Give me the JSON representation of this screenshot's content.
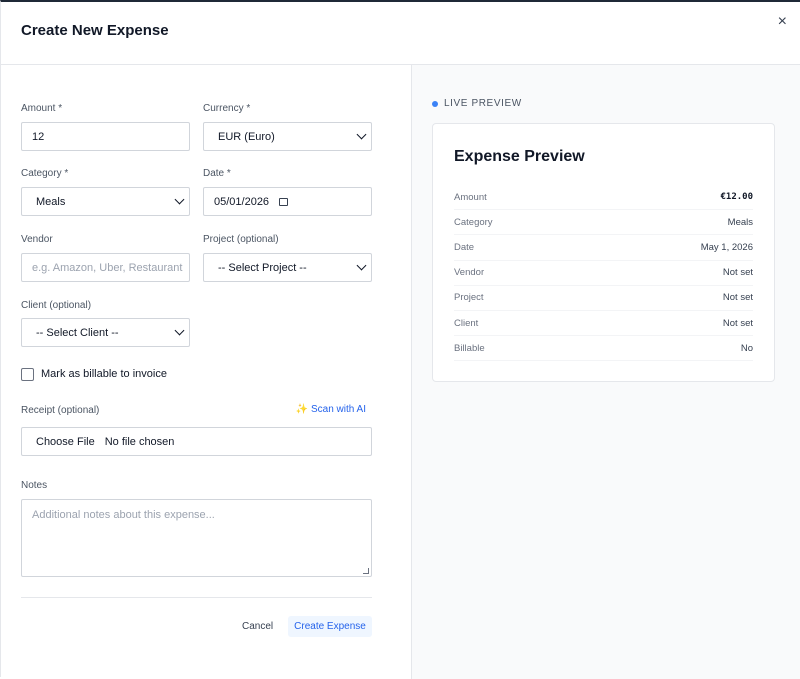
{
  "dialog": {
    "title": "Create New Expense",
    "close_glyph": "×"
  },
  "form": {
    "amount": {
      "label": "Amount *",
      "value": "12"
    },
    "currency": {
      "label": "Currency *",
      "value": "EUR (Euro)"
    },
    "category": {
      "label": "Category *",
      "value": "Meals"
    },
    "date": {
      "label": "Date *",
      "value": "05/01/2026"
    },
    "vendor": {
      "label": "Vendor",
      "placeholder": "e.g. Amazon, Uber, Restaurant"
    },
    "project": {
      "label": "Project (optional)",
      "value": "-- Select Project --"
    },
    "client": {
      "label": "Client (optional)",
      "value": "-- Select Client --"
    },
    "billable": {
      "label": "Mark as billable to invoice",
      "checked": false
    },
    "receipt": {
      "label": "Receipt (optional)",
      "scan_label": "✨ Scan with AI",
      "button_label": "Choose File",
      "status": "No file chosen"
    },
    "notes": {
      "label": "Notes",
      "placeholder": "Additional notes about this expense..."
    },
    "actions": {
      "cancel_label": "Cancel",
      "create_label": "Create Expense"
    }
  },
  "preview": {
    "badge": "LIVE PREVIEW",
    "title": "Expense Preview",
    "rows": [
      {
        "label": "Amount",
        "value": "€12.00"
      },
      {
        "label": "Category",
        "value": "Meals"
      },
      {
        "label": "Date",
        "value": "May 1, 2026"
      },
      {
        "label": "Vendor",
        "value": "Not set"
      },
      {
        "label": "Project",
        "value": "Not set"
      },
      {
        "label": "Client",
        "value": "Not set"
      },
      {
        "label": "Billable",
        "value": "No"
      }
    ]
  },
  "colors": {
    "accent": "#2563eb",
    "accent_bg": "#eff6ff",
    "live_dot": "#3b82f6"
  }
}
